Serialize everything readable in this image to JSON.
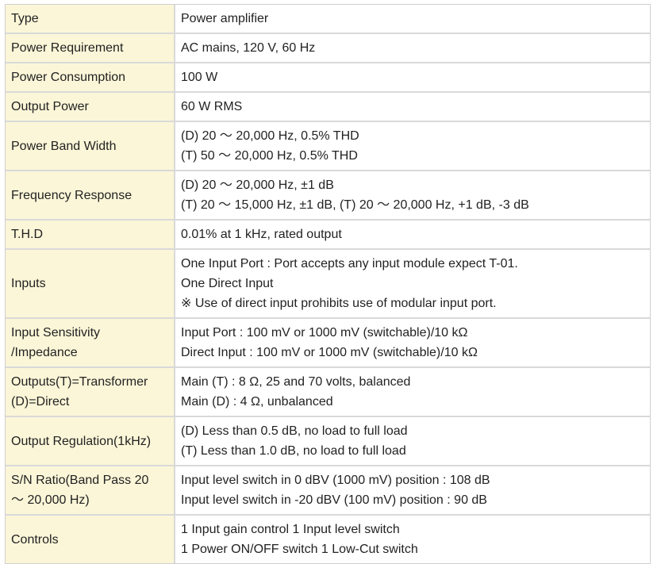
{
  "specs": [
    {
      "label": [
        "Type"
      ],
      "value": [
        "Power amplifier"
      ]
    },
    {
      "label": [
        "Power Requirement"
      ],
      "value": [
        "AC mains, 120 V, 60 Hz"
      ]
    },
    {
      "label": [
        "Power Consumption"
      ],
      "value": [
        "100 W"
      ]
    },
    {
      "label": [
        "Output Power"
      ],
      "value": [
        "60 W RMS"
      ]
    },
    {
      "label": [
        "Power Band Width"
      ],
      "value": [
        "(D) 20 〜 20,000 Hz, 0.5% THD",
        "(T) 50 〜 20,000 Hz, 0.5% THD"
      ]
    },
    {
      "label": [
        "Frequency Response"
      ],
      "value": [
        "(D) 20 〜 20,000 Hz, ±1 dB",
        "(T) 20 〜 15,000 Hz, ±1 dB, (T) 20 〜 20,000 Hz, +1 dB, -3 dB"
      ]
    },
    {
      "label": [
        "T.H.D"
      ],
      "value": [
        "0.01% at 1 kHz, rated output"
      ]
    },
    {
      "label": [
        "Inputs"
      ],
      "value": [
        "One Input Port : Port accepts any input module expect T-01.",
        "One Direct Input",
        "※ Use of direct input prohibits use of modular input port."
      ]
    },
    {
      "label": [
        "Input Sensitivity",
        "/Impedance"
      ],
      "value": [
        "Input Port : 100 mV or 1000 mV (switchable)/10 kΩ",
        "Direct Input : 100 mV or 1000 mV (switchable)/10 kΩ"
      ]
    },
    {
      "label": [
        "Outputs(T)=Transformer",
        "(D)=Direct"
      ],
      "value": [
        "Main (T) : 8 Ω, 25 and 70 volts, balanced",
        "Main (D) : 4 Ω, unbalanced"
      ]
    },
    {
      "label": [
        "Output Regulation(1kHz)"
      ],
      "value": [
        "(D) Less than 0.5 dB, no load to full load",
        "(T) Less than 1.0 dB, no load to full load"
      ]
    },
    {
      "label": [
        "S/N Ratio(Band Pass 20",
        "〜 20,000 Hz)"
      ],
      "value": [
        "Input level switch in 0 dBV (1000 mV) position : 108 dB",
        "Input level switch in -20 dBV (100 mV) position : 90 dB"
      ]
    },
    {
      "label": [
        "Controls"
      ],
      "value": [
        "1 Input gain control 1 Input level switch",
        "1 Power ON/OFF switch 1 Low-Cut switch"
      ]
    }
  ]
}
